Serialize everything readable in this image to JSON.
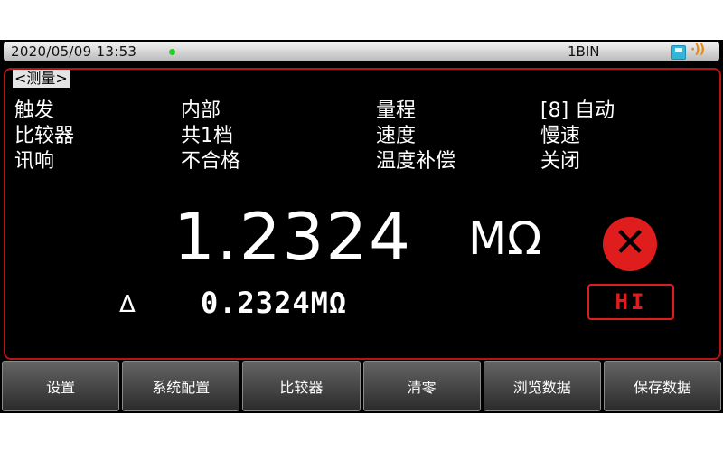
{
  "status_bar": {
    "datetime": "2020/05/09  13:53",
    "bin": "1BIN",
    "connected_indicator": "green",
    "icons": [
      "disk-icon",
      "wifi-icon"
    ]
  },
  "mode_tag": "<测量>",
  "params": {
    "trigger_label": "触发",
    "trigger_value": "内部",
    "comparator_label": "比较器",
    "comparator_value": "共1档",
    "beep_label": "讯响",
    "beep_value": "不合格",
    "range_label": "量程",
    "range_value": "[8] 自动",
    "speed_label": "速度",
    "speed_value": "慢速",
    "temp_comp_label": "温度补偿",
    "temp_comp_value": "关闭"
  },
  "reading": {
    "value": "1.2324",
    "unit": "MΩ",
    "status_icon": "error-x-icon"
  },
  "delta": {
    "symbol": "Δ",
    "value": "0.2324",
    "unit": "MΩ"
  },
  "result": "HI",
  "softkeys": [
    "设置",
    "系统配置",
    "比较器",
    "清零",
    "浏览数据",
    "保存数据"
  ],
  "colors": {
    "accent": "#e01d1d",
    "led": "#1fd21f",
    "background": "#000000",
    "status_bar": "#d6d6d6"
  }
}
